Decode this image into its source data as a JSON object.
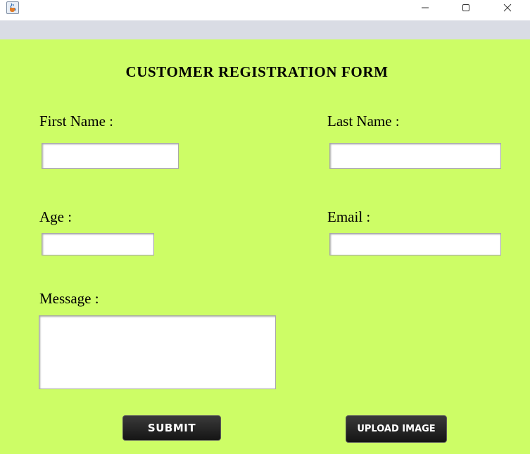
{
  "window": {
    "icon": "java-cup-icon",
    "controls": [
      "minimize-icon",
      "maximize-icon",
      "close-icon"
    ]
  },
  "form": {
    "title": "CUSTOMER REGISTRATION FORM",
    "first_name_label": "First Name :",
    "last_name_label": "Last Name :",
    "age_label": "Age :",
    "email_label": "Email :",
    "message_label": "Message :",
    "first_name_value": "",
    "last_name_value": "",
    "age_value": "",
    "email_value": "",
    "message_value": ""
  },
  "buttons": {
    "submit_label": "SUBMIT",
    "upload_label": "UPLOAD IMAGE"
  },
  "colors": {
    "background": "#cdfd66",
    "menubar": "#d9dce4",
    "button": "#1e1e1e"
  }
}
